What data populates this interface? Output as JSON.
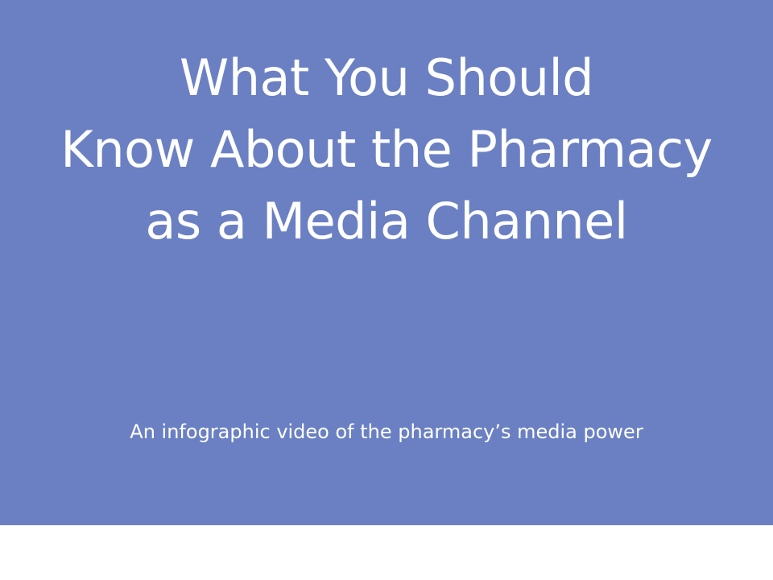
{
  "slide": {
    "title_lines": [
      "What You Should",
      "Know About the Pharmacy",
      "as a Media Channel"
    ],
    "subtitle": "An infographic video of the pharmacy’s media power"
  },
  "colors": {
    "background": "#6a80c3",
    "text": "#ffffff",
    "bottom_strip": "#ffffff"
  }
}
